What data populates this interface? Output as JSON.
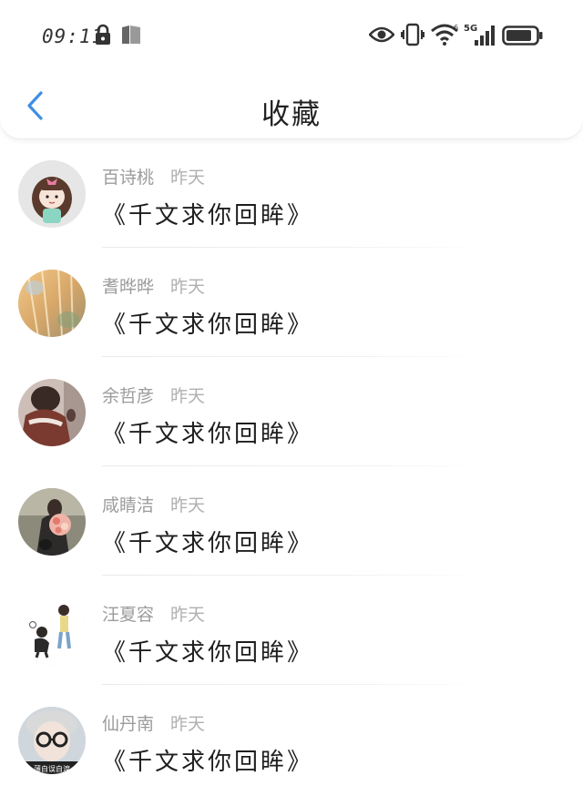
{
  "status_bar": {
    "time": "09:11",
    "network": "5G",
    "icons": [
      "lock-icon",
      "book-icon",
      "eye-icon",
      "vibrate-icon",
      "wifi-icon",
      "signal-icon",
      "battery-icon"
    ]
  },
  "header": {
    "title": "收藏",
    "back_icon": "chevron-left-icon"
  },
  "colors": {
    "accent": "#3d8ee6",
    "meta_text": "#9c9c9c"
  },
  "items": [
    {
      "author": "百诗桃",
      "time": "昨天",
      "title": "《千文求你回眸》",
      "avatar": "cartoon-girl"
    },
    {
      "author": "耆晔晔",
      "time": "昨天",
      "title": "《千文求你回眸》",
      "avatar": "golden-landscape"
    },
    {
      "author": "余哲彦",
      "time": "昨天",
      "title": "《千文求你回眸》",
      "avatar": "person-photo"
    },
    {
      "author": "咸睛洁",
      "time": "昨天",
      "title": "《千文求你回眸》",
      "avatar": "bouquet-photo"
    },
    {
      "author": "汪夏容",
      "time": "昨天",
      "title": "《千文求你回眸》",
      "avatar": "anime-couple"
    },
    {
      "author": "仙丹南",
      "time": "昨天",
      "title": "《千文求你回眸》",
      "avatar": "glasses-person",
      "avatar_caption": "薄自误自渡"
    }
  ]
}
